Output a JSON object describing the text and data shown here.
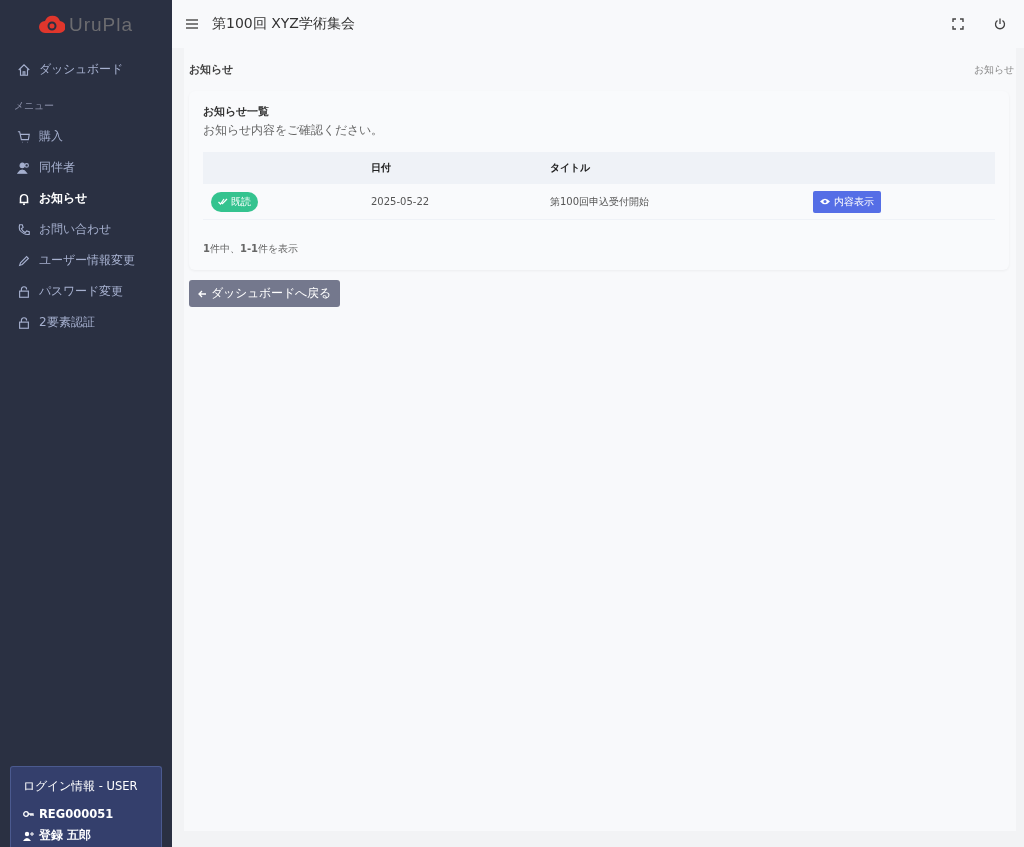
{
  "sidebar": {
    "logo": "UruPla",
    "items": [
      {
        "kind": "home",
        "label": "ダッシュボード",
        "selected": false
      },
      {
        "kind": "section",
        "label": "メニュー"
      },
      {
        "kind": "cart",
        "label": "購入",
        "selected": false
      },
      {
        "kind": "users",
        "label": "同伴者",
        "selected": false
      },
      {
        "kind": "bell",
        "label": "お知らせ",
        "selected": true
      },
      {
        "kind": "phone",
        "label": "お問い合わせ",
        "selected": false
      },
      {
        "kind": "pencil",
        "label": "ユーザー情報変更",
        "selected": false
      },
      {
        "kind": "lock",
        "label": "パスワード変更",
        "selected": false
      },
      {
        "kind": "lock",
        "label": "2要素認証",
        "selected": false
      }
    ],
    "login": {
      "title": "ログイン情報 - USER",
      "id": "REG000051",
      "name": "登録 五郎"
    }
  },
  "header": {
    "title": "第100回 XYZ学術集会"
  },
  "page": {
    "title": "お知らせ",
    "breadcrumb": "お知らせ"
  },
  "card": {
    "title": "お知らせ一覧",
    "subtitle": "お知らせ内容をご確認ください。",
    "columns": [
      "",
      "日付",
      "タイトル",
      ""
    ],
    "rows": [
      {
        "status": {
          "kind": "read",
          "label": "既読"
        },
        "date": "2025-05-22",
        "title": "第100回申込受付開始",
        "action": "内容表示"
      }
    ],
    "summary": "**1**件中、**1-1**件を表示"
  },
  "back_button": "ダッシュボードへ戻る"
}
